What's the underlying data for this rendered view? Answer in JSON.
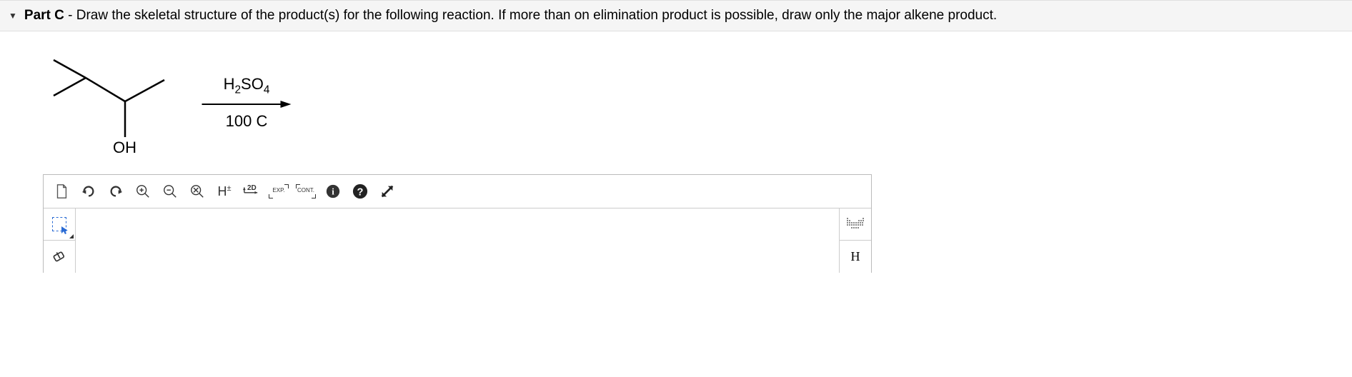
{
  "header": {
    "part_label": "Part C",
    "separator": " - ",
    "instruction": "Draw the skeletal structure of the product(s) for the following reaction. If more than on elimination product is possible, draw only the major alkene product."
  },
  "reaction": {
    "reagent_top": "H2SO4",
    "reagent_bottom": "100 C",
    "molecule_label_oh": "OH"
  },
  "toolbar": {
    "new": "New",
    "undo": "Undo",
    "redo": "Redo",
    "zoom_in": "Zoom In",
    "zoom_out": "Zoom Out",
    "delete": "Delete",
    "h_toggle": "H±",
    "two_d": "2D",
    "exp": "EXP.",
    "cont": "CONT.",
    "info": "Info",
    "help": "Help",
    "fullscreen": "Fullscreen"
  },
  "left_tools": {
    "marquee": "Marquee Select",
    "eraser": "Eraser"
  },
  "right_tools": {
    "periodic": "Periodic Table",
    "hydrogen": "H"
  }
}
